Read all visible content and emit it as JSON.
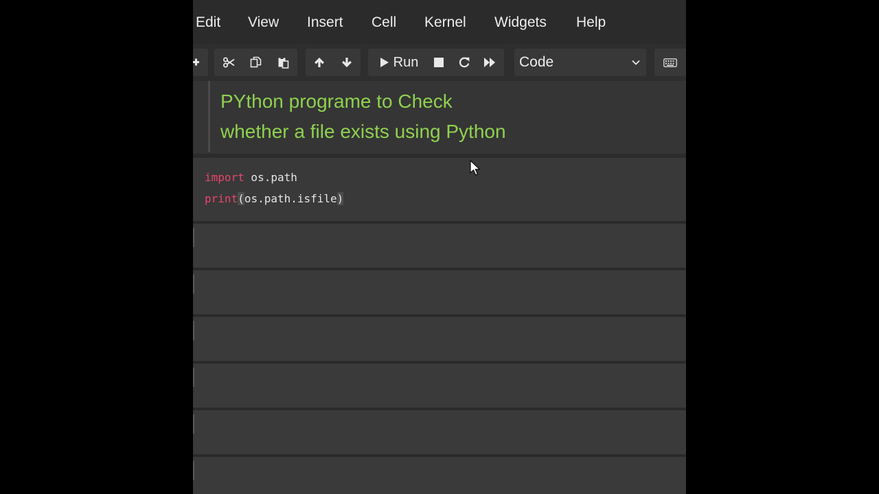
{
  "menubar": {
    "items": [
      "Edit",
      "View",
      "Insert",
      "Cell",
      "Kernel",
      "Widgets",
      "Help"
    ]
  },
  "toolbar": {
    "buttons": [
      {
        "icon": "add-cell-icon"
      },
      {
        "icon": "cut-icon"
      },
      {
        "icon": "copy-icon"
      },
      {
        "icon": "paste-icon"
      },
      {
        "icon": "move-up-icon"
      },
      {
        "icon": "move-down-icon"
      },
      {
        "icon": "run-icon"
      },
      {
        "icon": "stop-icon"
      },
      {
        "icon": "restart-icon"
      },
      {
        "icon": "fast-forward-icon"
      },
      {
        "icon": "keyboard-icon"
      }
    ],
    "run_label": "Run",
    "cell_type": {
      "selected": "Code"
    }
  },
  "notebook": {
    "markdown_cell": {
      "line1": "PYthon programe to Check",
      "line2": "whether a file exists using Python"
    },
    "code_cell": {
      "line1_keyword": "import",
      "line1_rest": " os.path",
      "line2_func": "print",
      "line2_open": "(",
      "line2_args": "os.path.isfile",
      "line2_close": ")"
    }
  },
  "colors": {
    "markdown_heading": "#8fd14f",
    "keyword": "#e8456b",
    "background": "#343434",
    "menubar": "#2b2b2b"
  }
}
